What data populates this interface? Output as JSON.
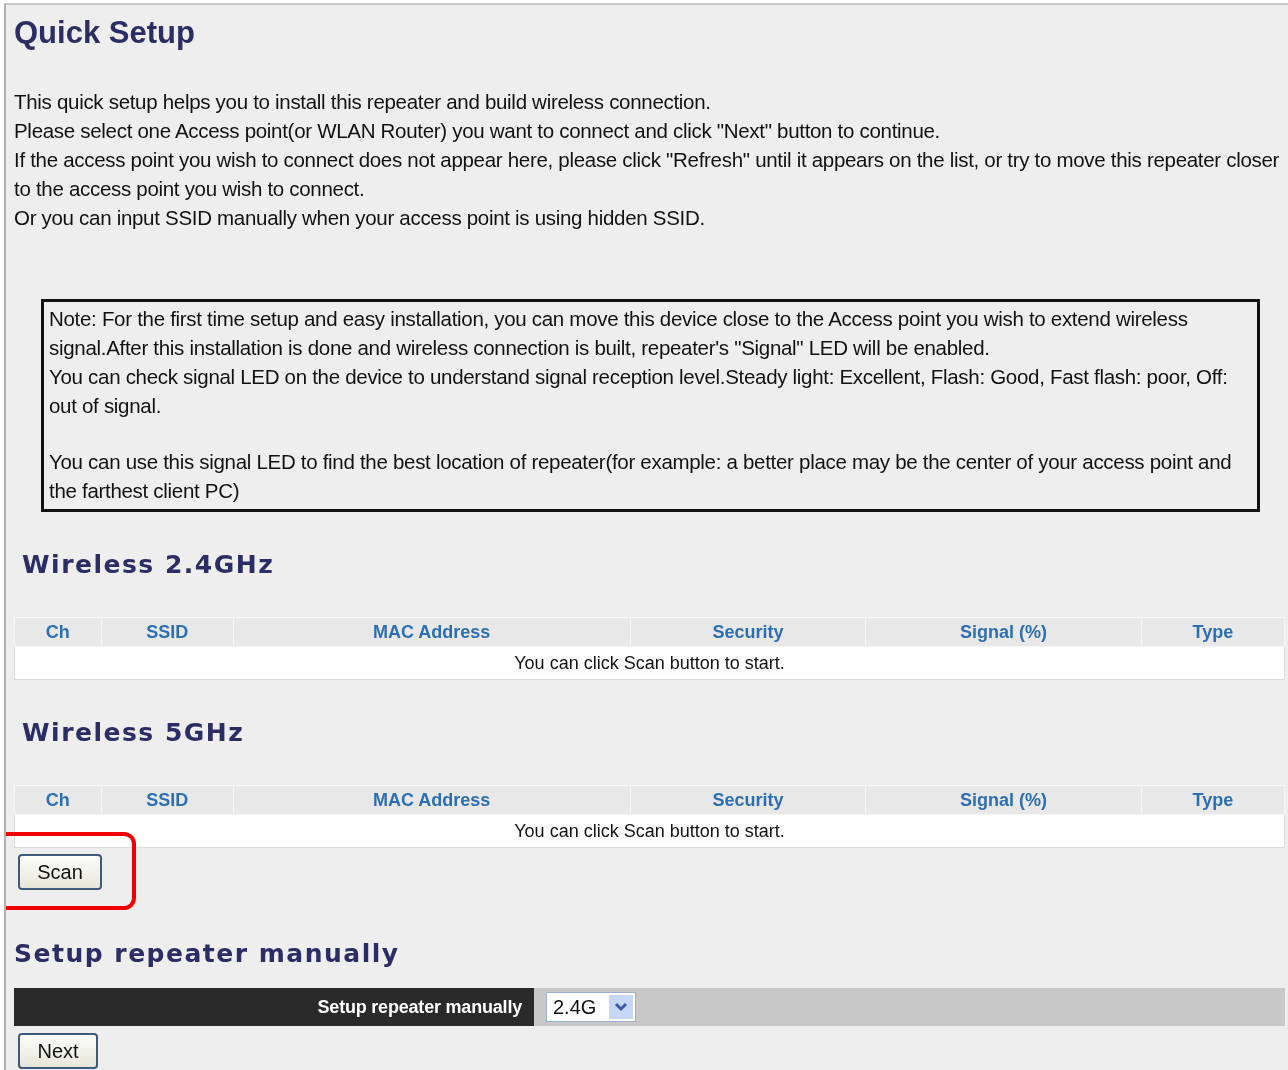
{
  "title": "Quick Setup",
  "intro": [
    "This quick setup helps you to install this repeater and build wireless connection.",
    "Please select one Access point(or WLAN Router) you want to connect and click \"Next\" button to continue.",
    "If the access point you wish to connect does not appear here, please click \"Refresh\" until it appears on the list, or try to move this repeater closer to the access point you wish to connect.",
    "Or you can input SSID manually when your access point is using hidden SSID."
  ],
  "note": [
    "Note: For the first time setup and easy installation, you can move this device close to the Access point you wish to extend wireless signal.After this installation is done and wireless connection is built, repeater's \"Signal\" LED will be enabled.",
    "You can check signal LED on the device to understand signal reception level.Steady light: Excellent, Flash: Good, Fast flash: poor, Off: out of signal.",
    "You can use this signal LED to find the best location of repeater(for example: a better place may be the center of your access point and the farthest client PC)"
  ],
  "networks": [
    {
      "heading": "Wireless 2.4GHz",
      "columns": [
        "Ch",
        "SSID",
        "MAC Address",
        "Security",
        "Signal (%)",
        "Type"
      ],
      "empty_message": "You can click Scan button to start."
    },
    {
      "heading": "Wireless 5GHz",
      "columns": [
        "Ch",
        "SSID",
        "MAC Address",
        "Security",
        "Signal (%)",
        "Type"
      ],
      "empty_message": "You can click Scan button to start."
    }
  ],
  "scan_button": {
    "label": "Scan",
    "highlighted": true
  },
  "manual": {
    "heading": "Setup repeater manually",
    "label": "Setup repeater manually",
    "band": "2.4G"
  },
  "next_button": "Next"
}
